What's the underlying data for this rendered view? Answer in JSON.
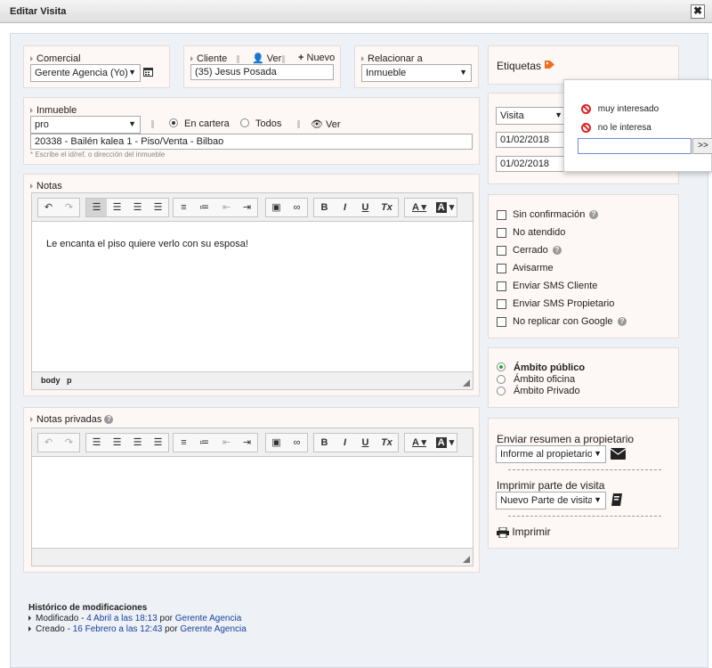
{
  "window": {
    "title": "Editar Visita",
    "close": "✖"
  },
  "comercial": {
    "label": "Comercial",
    "value": "Gerente Agencia (Yo)"
  },
  "cliente": {
    "label": "Cliente",
    "ver": "Ver",
    "nuevo": "Nuevo",
    "value": "(35) Jesus Posada"
  },
  "relacionar": {
    "label": "Relacionar a",
    "value": "Inmueble"
  },
  "etiquetas": {
    "label": "Etiquetas"
  },
  "inmueble": {
    "label": "Inmueble",
    "select": "pro",
    "en_cartera": "En cartera",
    "todos": "Todos",
    "ver": "Ver",
    "value": "20338 - Bailén kalea 1 - Piso/Venta - Bilbao",
    "hint": "* Escribe el id/ref. o dirección del inmueble"
  },
  "tipo": {
    "value": "Visita"
  },
  "fechas": {
    "inicio": "01/02/2018",
    "fin": "01/02/2018"
  },
  "popup": {
    "tags": [
      "muy interesado",
      "no le interesa"
    ],
    "input_value": "",
    "go": ">>"
  },
  "notas": {
    "label": "Notas",
    "content": "Le encanta el piso quiere verlo con su esposa!",
    "status_body": "body",
    "status_p": "p"
  },
  "notas_privadas": {
    "label": "Notas privadas"
  },
  "toolbar": {
    "bold": "B",
    "italic": "I",
    "underline": "U",
    "clear": "Tx",
    "color": "A",
    "bgcolor": "A"
  },
  "opciones": {
    "items": [
      {
        "label": "Sin confirmación",
        "help": true
      },
      {
        "label": "No atendido",
        "help": false
      },
      {
        "label": "Cerrado",
        "help": true
      },
      {
        "label": "Avisarme",
        "help": false
      },
      {
        "label": "Enviar SMS Cliente",
        "help": false
      },
      {
        "label": "Enviar SMS Propietario",
        "help": false
      },
      {
        "label": "No replicar con Google",
        "help": true
      }
    ]
  },
  "ambito": {
    "publico": "Ámbito público",
    "oficina": "Ámbito oficina",
    "privado": "Ámbito Privado",
    "selected": "publico"
  },
  "resumen": {
    "label": "Enviar resumen a propietario",
    "value": "Informe al propietario"
  },
  "parte": {
    "label": "Imprimir parte de visita",
    "value": "Nuevo Parte de visita"
  },
  "imprimir": {
    "label": "Imprimir"
  },
  "historico": {
    "title": "Histórico de modificaciones",
    "rows": [
      {
        "action": "Modificado",
        "date": "4 Abril a las 18:13",
        "por": "por",
        "user": "Gerente Agencia"
      },
      {
        "action": "Creado",
        "date": "16 Febrero a las 12:43",
        "por": "por",
        "user": "Gerente Agencia"
      }
    ]
  },
  "colors": {
    "accent_green": "#22aa22",
    "tag_orange": "#f07020",
    "link": "#1a3f9b",
    "panel_bg": "#fdf7f5"
  }
}
